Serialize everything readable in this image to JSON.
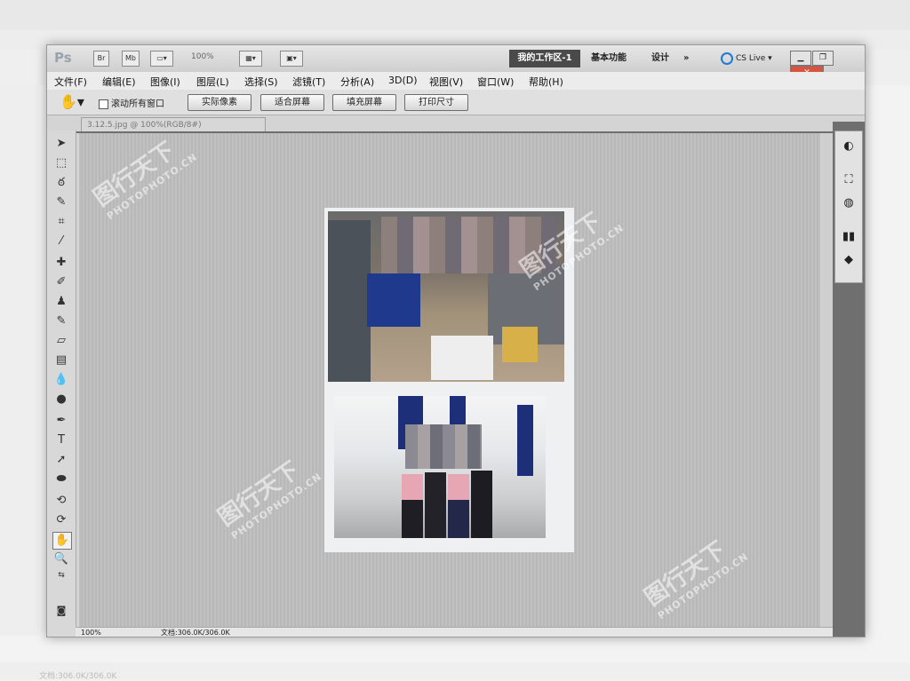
{
  "app": {
    "logo": "Ps",
    "zoom_readout": "100%",
    "workspaces": {
      "active": "我的工作区-1",
      "basic": "基本功能",
      "design": "设计",
      "more": "»"
    },
    "cs_live": "CS Live ▾"
  },
  "menu": [
    "文件(F)",
    "编辑(E)",
    "图像(I)",
    "图层(L)",
    "选择(S)",
    "滤镜(T)",
    "分析(A)",
    "3D(D)",
    "视图(V)",
    "窗口(W)",
    "帮助(H)"
  ],
  "options": {
    "scroll_all": "滚动所有窗口",
    "buttons": [
      "实际像素",
      "适合屏幕",
      "填充屏幕",
      "打印尺寸"
    ]
  },
  "document": {
    "tab_title": "3.12.5.jpg @ 100%(RGB/8#)",
    "status_zoom": "100%",
    "status_doc": "文档:306.0K/306.0K"
  },
  "tools": [
    "move",
    "marquee",
    "lasso",
    "quick-select",
    "crop",
    "eyedropper",
    "healing",
    "brush",
    "stamp",
    "history-brush",
    "eraser",
    "gradient",
    "blur",
    "dodge",
    "pen",
    "type",
    "path-select",
    "shape",
    "3d-rotate",
    "3d-orbit",
    "hand",
    "zoom"
  ],
  "watermark": {
    "cn": "图行天下",
    "en": "PHOTOPHOTO.CN"
  }
}
